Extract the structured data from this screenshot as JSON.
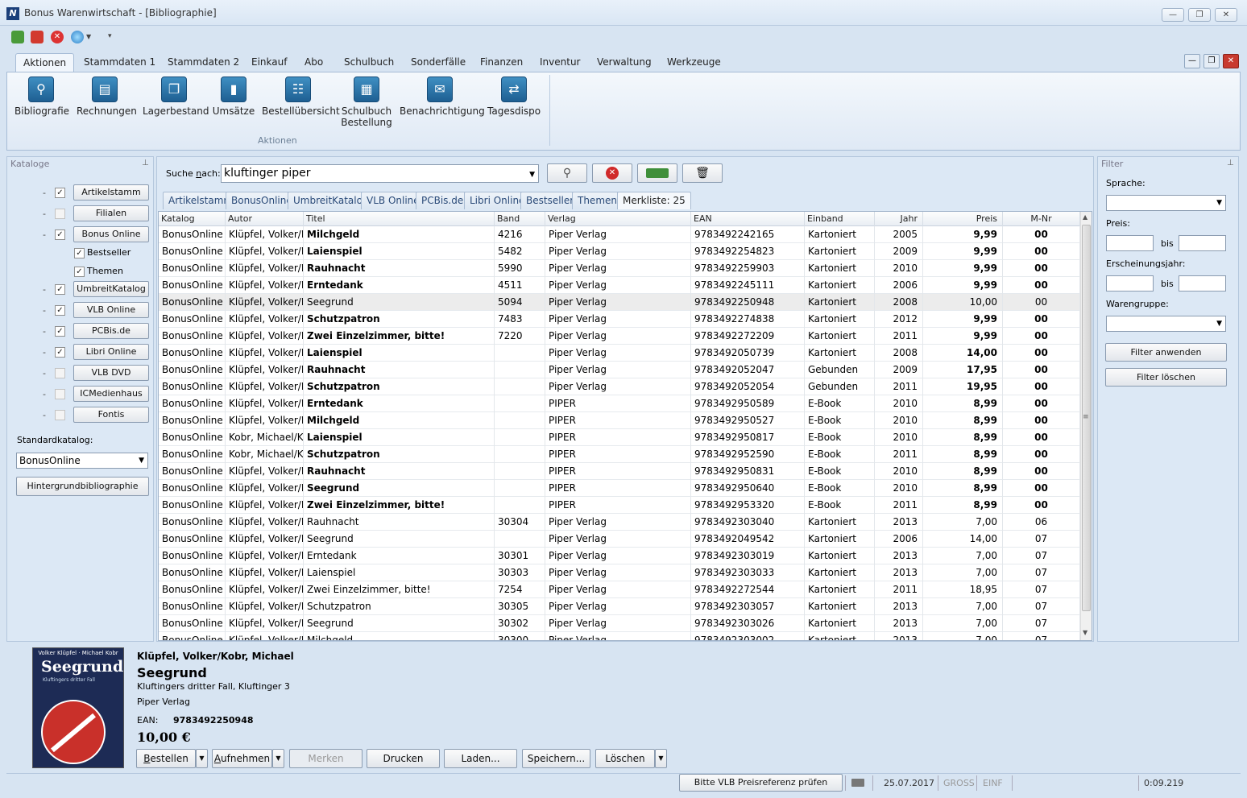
{
  "window": {
    "title": "Bonus Warenwirtschaft - [Bibliographie]",
    "app_icon": "N",
    "controls": [
      "minimize",
      "restore",
      "close"
    ]
  },
  "quick_access": [
    "refresh-icon",
    "calendar-icon",
    "stop-icon",
    "globe-icon",
    "customize-icon"
  ],
  "ribbon": {
    "tabs": [
      "Aktionen",
      "Stammdaten 1",
      "Stammdaten 2",
      "Einkauf",
      "Abo",
      "Schulbuch",
      "Sonderfälle",
      "Finanzen",
      "Inventur",
      "Verwaltung",
      "Werkzeuge"
    ],
    "active_tab": "Aktionen",
    "buttons": [
      {
        "label": "Bibliografie",
        "icon": "magnifier-icon"
      },
      {
        "label": "Rechnungen",
        "icon": "cabinet-icon"
      },
      {
        "label": "Lagerbestand",
        "icon": "stack-icon"
      },
      {
        "label": "Umsätze",
        "icon": "bar-chart-icon"
      },
      {
        "label": "Bestellübersicht",
        "icon": "clipboard-icon"
      },
      {
        "label": "Schulbuch",
        "label2": "Bestellung",
        "icon": "book-icon"
      },
      {
        "label": "Benachrichtigung",
        "icon": "envelope-icon"
      },
      {
        "label": "Tagesdispo",
        "icon": "cycle-icon"
      }
    ],
    "group_label": "Aktionen"
  },
  "kataloge": {
    "title": "Kataloge",
    "items": [
      {
        "label": "Artikelstamm",
        "checked": true
      },
      {
        "label": "Filialen",
        "checked": false
      },
      {
        "label": "Bonus Online",
        "checked": true
      },
      {
        "label": "UmbreitKatalog",
        "checked": true
      },
      {
        "label": "VLB Online",
        "checked": true
      },
      {
        "label": "PCBis.de",
        "checked": true
      },
      {
        "label": "Libri Online",
        "checked": true
      },
      {
        "label": "VLB DVD",
        "checked": false
      },
      {
        "label": "ICMedienhaus",
        "checked": false
      },
      {
        "label": "Fontis",
        "checked": false
      }
    ],
    "sub_items": [
      {
        "label": "Bestseller",
        "checked": true
      },
      {
        "label": "Themen",
        "checked": true
      }
    ],
    "standard_label": "Standardkatalog:",
    "standard_value": "BonusOnline",
    "background_button": "Hintergrundbibliographie"
  },
  "search": {
    "label_prefix": "Suche ",
    "label_underlined": "n",
    "label_suffix": "ach:",
    "value": "kluftinger piper"
  },
  "result_tabs": [
    "Artikelstamm",
    "BonusOnline",
    "UmbreitKatalog",
    "VLB Online",
    "PCBis.de",
    "Libri Online",
    "Bestseller",
    "Themen",
    "Merkliste: 25"
  ],
  "grid": {
    "columns": [
      "Katalog",
      "Autor",
      "Titel",
      "Band",
      "Verlag",
      "EAN",
      "Einband",
      "Jahr",
      "Preis",
      "M-Nr"
    ],
    "rows": [
      [
        "BonusOnline",
        "Klüpfel, Volker/Kobr, Michael",
        "Milchgeld",
        "4216",
        "Piper Verlag",
        "9783492242165",
        "Kartoniert",
        "2005",
        "9,99",
        "00",
        true
      ],
      [
        "BonusOnline",
        "Klüpfel, Volker/Kobr, Michael",
        "Laienspiel",
        "5482",
        "Piper Verlag",
        "9783492254823",
        "Kartoniert",
        "2009",
        "9,99",
        "00",
        true
      ],
      [
        "BonusOnline",
        "Klüpfel, Volker/Kobr, Michael",
        "Rauhnacht",
        "5990",
        "Piper Verlag",
        "9783492259903",
        "Kartoniert",
        "2010",
        "9,99",
        "00",
        true
      ],
      [
        "BonusOnline",
        "Klüpfel, Volker/Kobr, Michael",
        "Erntedank",
        "4511",
        "Piper Verlag",
        "9783492245111",
        "Kartoniert",
        "2006",
        "9,99",
        "00",
        true
      ],
      [
        "BonusOnline",
        "Klüpfel, Volker/Kobr, Michael",
        "Seegrund",
        "5094",
        "Piper Verlag",
        "9783492250948",
        "Kartoniert",
        "2008",
        "10,00",
        "00",
        false,
        true
      ],
      [
        "BonusOnline",
        "Klüpfel, Volker/Kobr, Michael",
        "Schutzpatron",
        "7483",
        "Piper Verlag",
        "9783492274838",
        "Kartoniert",
        "2012",
        "9,99",
        "00",
        true
      ],
      [
        "BonusOnline",
        "Klüpfel, Volker/Kobr, Michael",
        "Zwei Einzelzimmer, bitte!",
        "7220",
        "Piper Verlag",
        "9783492272209",
        "Kartoniert",
        "2011",
        "9,99",
        "00",
        true
      ],
      [
        "BonusOnline",
        "Klüpfel, Volker/Kobr, Michael",
        "Laienspiel",
        "",
        "Piper Verlag",
        "9783492050739",
        "Kartoniert",
        "2008",
        "14,00",
        "00",
        true
      ],
      [
        "BonusOnline",
        "Klüpfel, Volker/Kobr, Michael",
        "Rauhnacht",
        "",
        "Piper Verlag",
        "9783492052047",
        "Gebunden",
        "2009",
        "17,95",
        "00",
        true
      ],
      [
        "BonusOnline",
        "Klüpfel, Volker/Kobr, Michael",
        "Schutzpatron",
        "",
        "Piper Verlag",
        "9783492052054",
        "Gebunden",
        "2011",
        "19,95",
        "00",
        true
      ],
      [
        "BonusOnline",
        "Klüpfel, Volker/Kobr, Michael",
        "Erntedank",
        "",
        "PIPER",
        "9783492950589",
        "E-Book",
        "2010",
        "8,99",
        "00",
        true
      ],
      [
        "BonusOnline",
        "Klüpfel, Volker/Kobr, Michael",
        "Milchgeld",
        "",
        "PIPER",
        "9783492950527",
        "E-Book",
        "2010",
        "8,99",
        "00",
        true
      ],
      [
        "BonusOnline",
        "Kobr, Michael/Klüpfel, Volker",
        "Laienspiel",
        "",
        "PIPER",
        "9783492950817",
        "E-Book",
        "2010",
        "8,99",
        "00",
        true
      ],
      [
        "BonusOnline",
        "Kobr, Michael/Klüpfel, Volker",
        "Schutzpatron",
        "",
        "PIPER",
        "9783492952590",
        "E-Book",
        "2011",
        "8,99",
        "00",
        true
      ],
      [
        "BonusOnline",
        "Klüpfel, Volker/Kobr, Michael",
        "Rauhnacht",
        "",
        "PIPER",
        "9783492950831",
        "E-Book",
        "2010",
        "8,99",
        "00",
        true
      ],
      [
        "BonusOnline",
        "Klüpfel, Volker/Kobr, Michael",
        "Seegrund",
        "",
        "PIPER",
        "9783492950640",
        "E-Book",
        "2010",
        "8,99",
        "00",
        true
      ],
      [
        "BonusOnline",
        "Klüpfel, Volker/Kobr, Michael",
        "Zwei Einzelzimmer, bitte!",
        "",
        "PIPER",
        "9783492953320",
        "E-Book",
        "2011",
        "8,99",
        "00",
        true
      ],
      [
        "BonusOnline",
        "Klüpfel, Volker/Kobr, Michael",
        "Rauhnacht",
        "30304",
        "Piper Verlag",
        "9783492303040",
        "Kartoniert",
        "2013",
        "7,00",
        "06",
        false
      ],
      [
        "BonusOnline",
        "Klüpfel, Volker/Kobr, Michael",
        "Seegrund",
        "",
        "Piper Verlag",
        "9783492049542",
        "Kartoniert",
        "2006",
        "14,00",
        "07",
        false
      ],
      [
        "BonusOnline",
        "Klüpfel, Volker/Kobr, Michael",
        "Erntedank",
        "30301",
        "Piper Verlag",
        "9783492303019",
        "Kartoniert",
        "2013",
        "7,00",
        "07",
        false
      ],
      [
        "BonusOnline",
        "Klüpfel, Volker/Kobr, Michael",
        "Laienspiel",
        "30303",
        "Piper Verlag",
        "9783492303033",
        "Kartoniert",
        "2013",
        "7,00",
        "07",
        false
      ],
      [
        "BonusOnline",
        "Klüpfel, Volker/Kobr, Michael",
        "Zwei Einzelzimmer, bitte!",
        "7254",
        "Piper Verlag",
        "9783492272544",
        "Kartoniert",
        "2011",
        "18,95",
        "07",
        false
      ],
      [
        "BonusOnline",
        "Klüpfel, Volker/Kobr, Michael",
        "Schutzpatron",
        "30305",
        "Piper Verlag",
        "9783492303057",
        "Kartoniert",
        "2013",
        "7,00",
        "07",
        false
      ],
      [
        "BonusOnline",
        "Klüpfel, Volker/Kobr, Michael",
        "Seegrund",
        "30302",
        "Piper Verlag",
        "9783492303026",
        "Kartoniert",
        "2013",
        "7,00",
        "07",
        false
      ],
      [
        "BonusOnline",
        "Klüpfel, Volker/Kobr, Michael",
        "Milchgeld",
        "30300",
        "Piper Verlag",
        "9783492303002",
        "Kartoniert",
        "2013",
        "7,00",
        "07",
        false
      ]
    ]
  },
  "filter": {
    "title": "Filter",
    "sprache_label": "Sprache:",
    "preis_label": "Preis:",
    "bis": "bis",
    "jahr_label": "Erscheinungsjahr:",
    "warengruppe_label": "Warengruppe:",
    "apply_button": "Filter anwenden",
    "clear_button": "Filter löschen"
  },
  "detail": {
    "author": "Klüpfel, Volker/Kobr, Michael",
    "title": "Seegrund",
    "subtitle": "Kluftingers dritter Fall, Kluftinger 3",
    "publisher": "Piper Verlag",
    "ean_label": "EAN:",
    "ean": "9783492250948",
    "price": "10,00 €",
    "cover": {
      "authors": "Volker Klüpfel · Michael Kobr",
      "title": "Seegrund",
      "subtitle": "Kluftingers dritter Fall"
    },
    "buttons": {
      "bestellen_u": "B",
      "bestellen_rest": "estellen",
      "aufnehmen_u": "A",
      "aufnehmen_rest": "ufnehmen",
      "merken": "Merken",
      "drucken": "Drucken",
      "laden": "Laden...",
      "speichern": "Speichern...",
      "loeschen": "Löschen"
    }
  },
  "status": {
    "button": "Bitte VLB Preisreferenz prüfen",
    "date": "25.07.2017",
    "gross": "GROSS",
    "einf": "EINF",
    "time": "0:09.219"
  }
}
